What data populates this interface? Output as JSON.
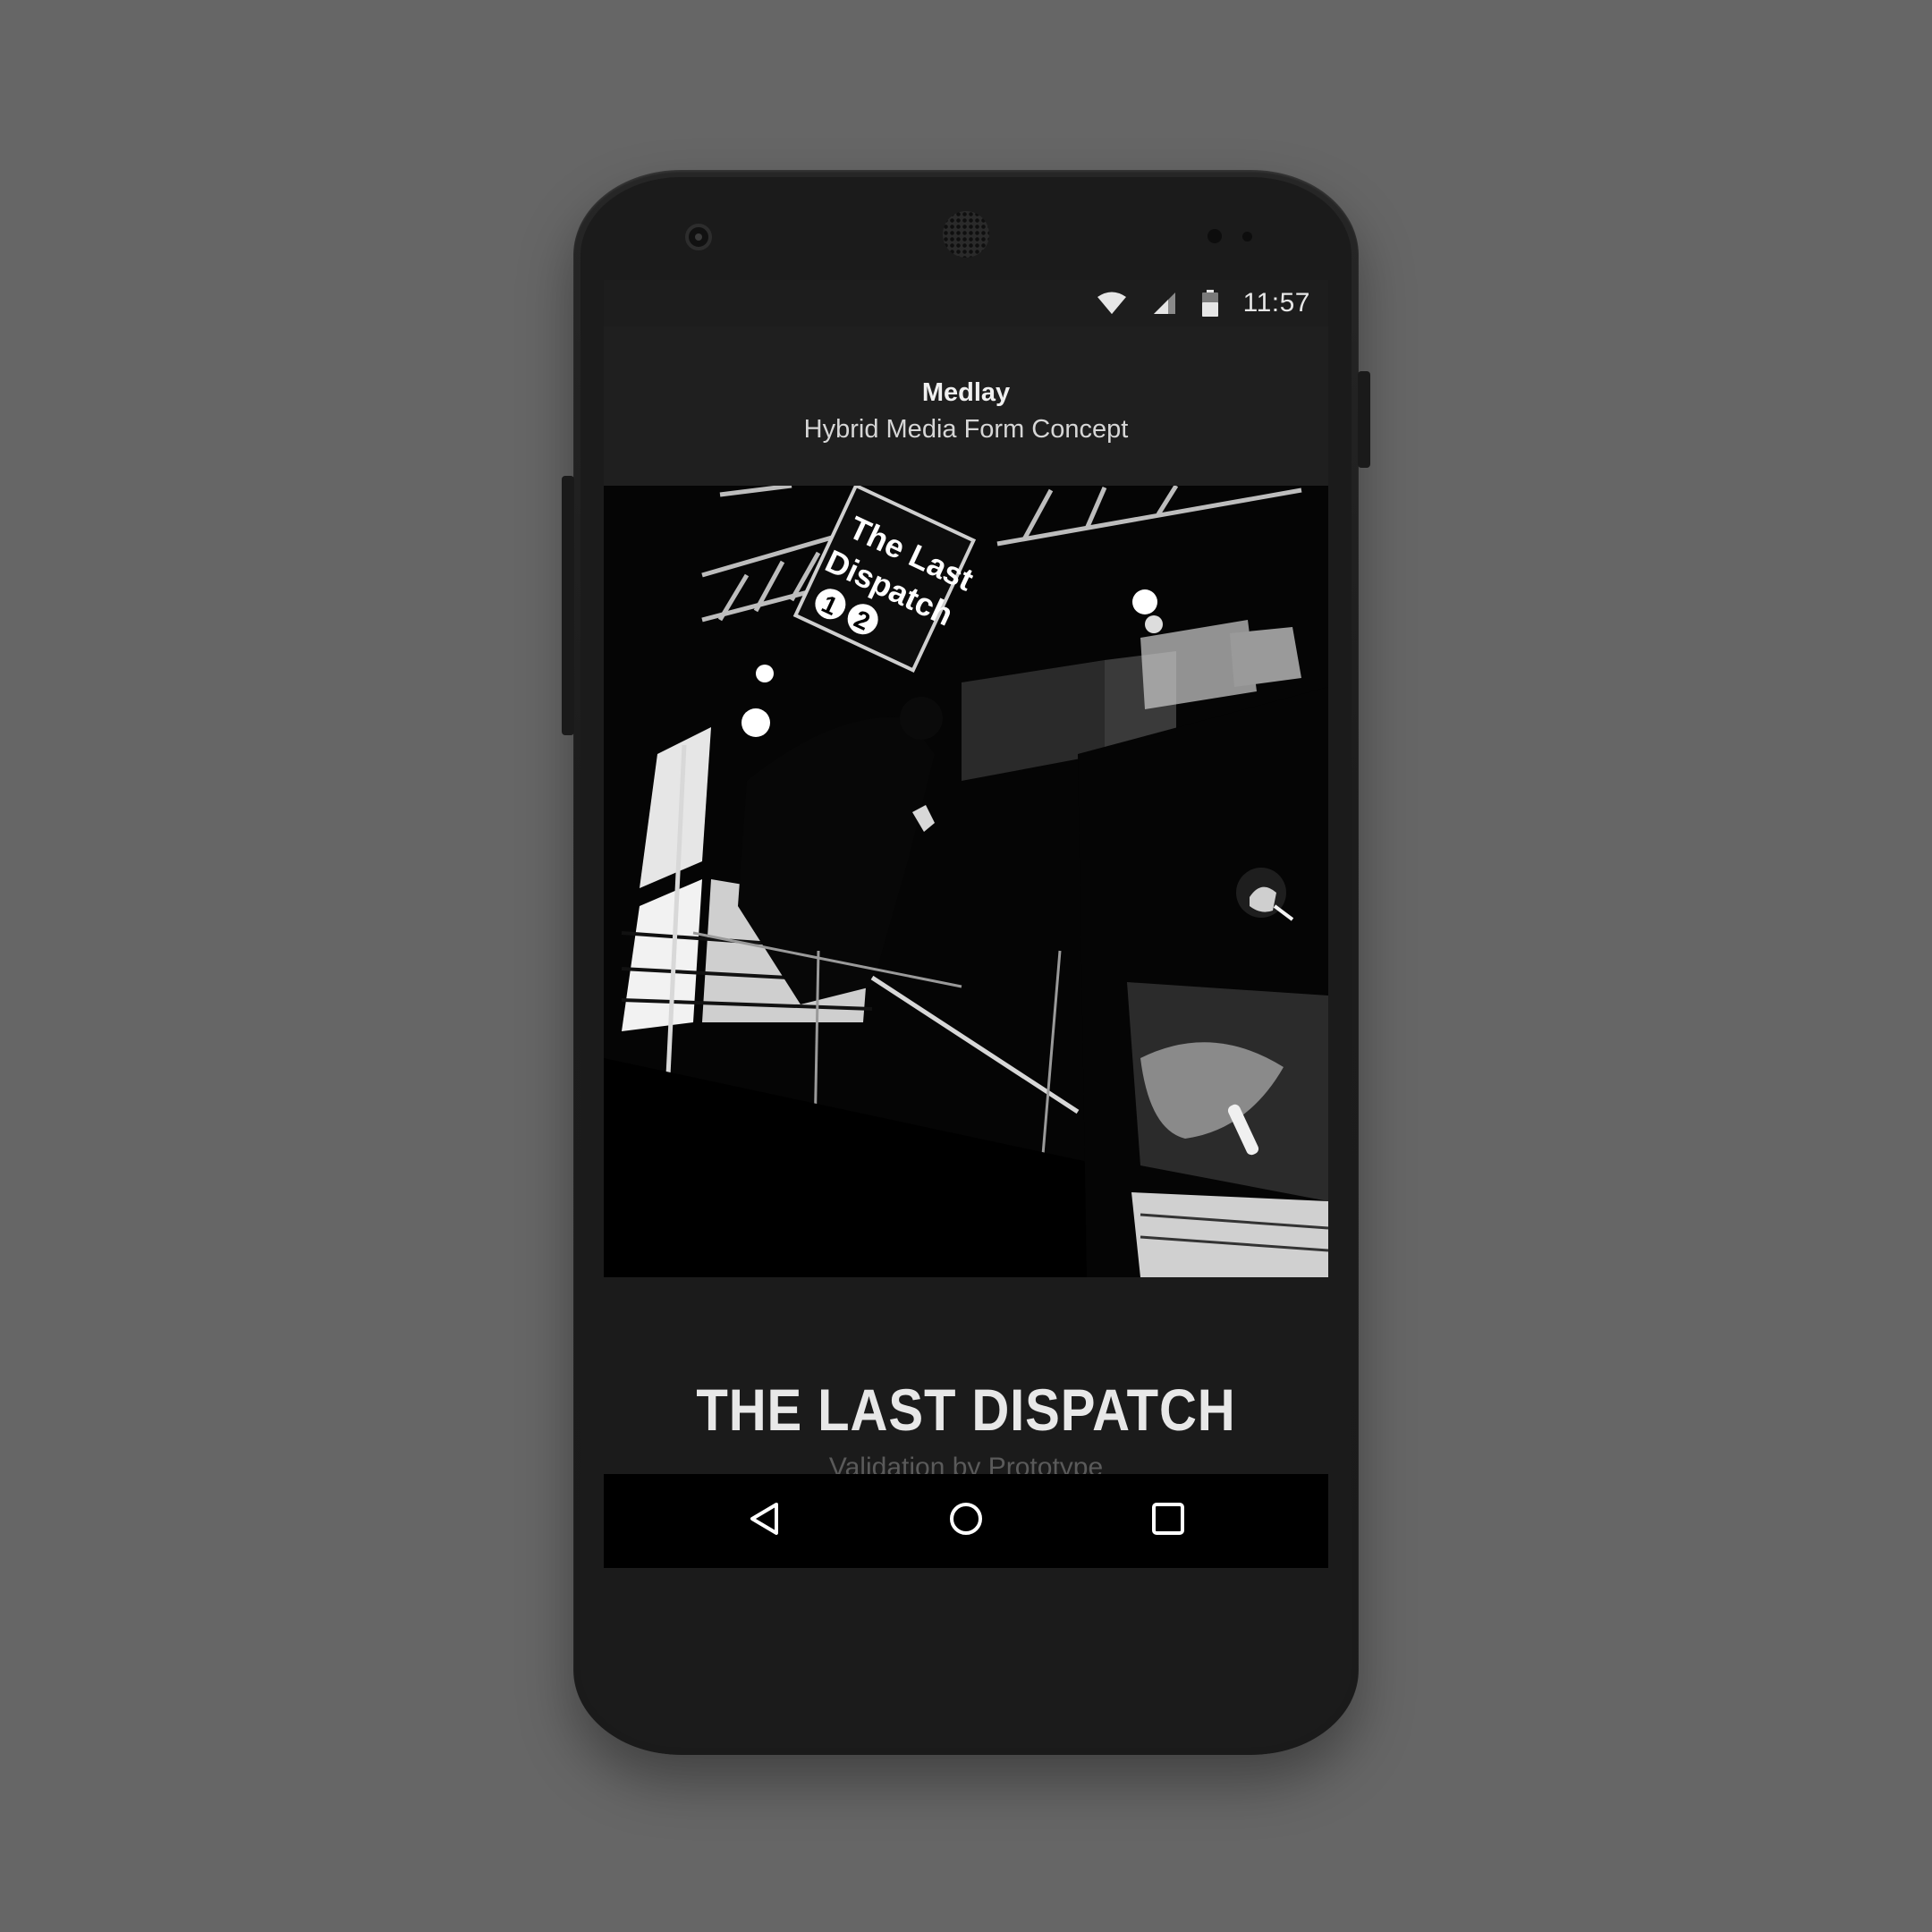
{
  "status_bar": {
    "time": "11:57",
    "icons": [
      "wifi-icon",
      "cell-signal-icon",
      "battery-icon"
    ]
  },
  "header": {
    "title": "Medlay",
    "subtitle": "Hybrid Media Form Concept"
  },
  "hero_image": {
    "sign_line1": "The Last",
    "sign_line2": "Dispatch",
    "sign_numbers": [
      "1",
      "2"
    ]
  },
  "story": {
    "title": "THE LAST DISPATCH",
    "subtitle": "Validation by Prototype"
  },
  "nav_bar": {
    "icons": [
      "back-icon",
      "home-icon",
      "recent-apps-icon"
    ]
  },
  "colors": {
    "background": "#666666",
    "phone_body": "#1b1b1b",
    "screen": "#1f1f1f",
    "nav_bar": "#000000",
    "title_text": "#e8e8e8"
  }
}
